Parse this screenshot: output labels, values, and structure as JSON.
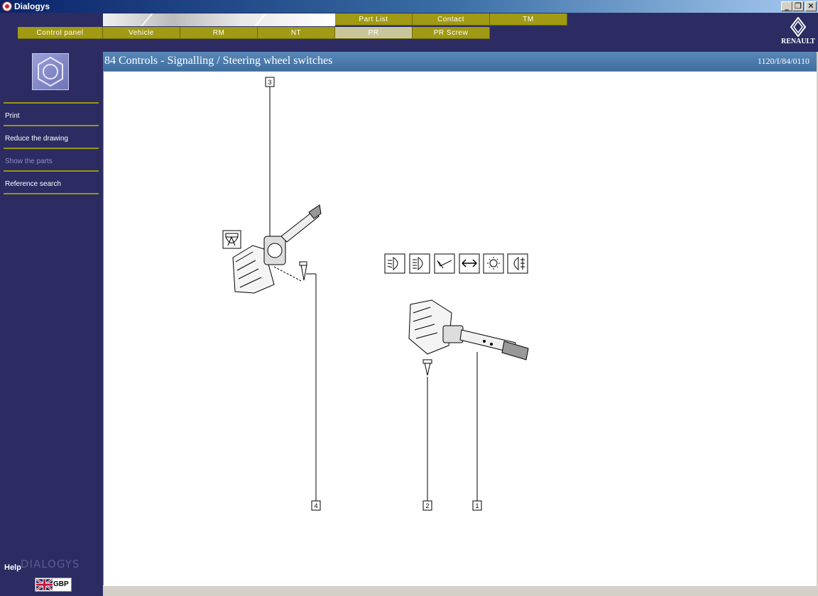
{
  "window": {
    "title": "Dialogys"
  },
  "nav": {
    "top_row": [
      "Part List",
      "Contact",
      "TM"
    ],
    "bottom_row": [
      "Control panel",
      "Vehicle",
      "RM",
      "NT",
      "PR",
      "PR Screw"
    ],
    "active": "PR"
  },
  "logo": {
    "brand": "RENAULT"
  },
  "sidebar": {
    "icon": "hexagon-nut-icon",
    "menu": [
      {
        "label": "Print",
        "enabled": true
      },
      {
        "label": "Reduce the drawing",
        "enabled": true
      },
      {
        "label": "Show the parts",
        "enabled": false
      },
      {
        "label": "Reference search",
        "enabled": true
      }
    ],
    "help": "Help",
    "brand": "DIALOGYS",
    "language": "GBP"
  },
  "document": {
    "title": "84 Controls - Signalling / Steering wheel switches",
    "reference": "1120/I/84/0110"
  },
  "drawing": {
    "callouts": [
      "3",
      "4",
      "2",
      "1"
    ],
    "symbols": [
      "wiper-symbol-icon",
      "dipped-beam-icon",
      "main-beam-icon",
      "horn-icon",
      "direction-indicator-icon",
      "side-light-icon",
      "rear-fog-light-icon"
    ]
  }
}
